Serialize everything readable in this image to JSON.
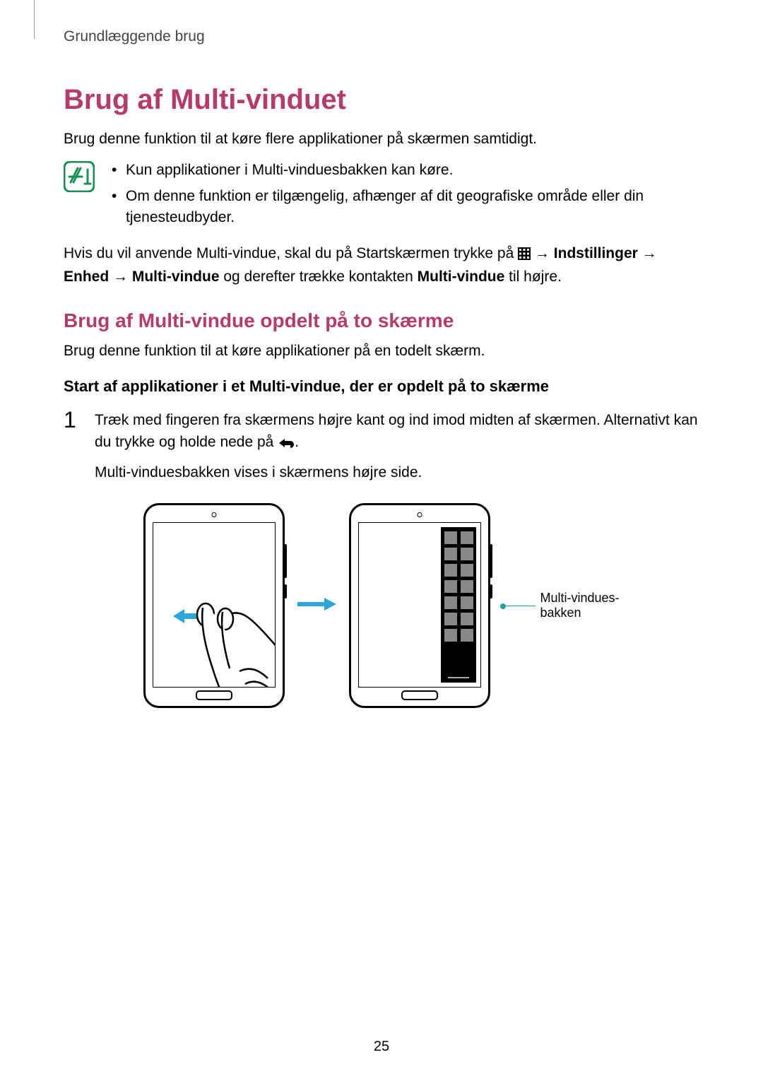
{
  "runningHead": "Grundlæggende brug",
  "title": "Brug af Multi-vinduet",
  "intro": "Brug denne funktion til at køre flere applikationer på skærmen samtidigt.",
  "notes": [
    "Kun applikationer i Multi-vinduesbakken kan køre.",
    "Om denne funktion er tilgængelig, afhænger af dit geografiske område eller din tjenesteudbyder."
  ],
  "para2_pre": "Hvis du vil anvende Multi-vindue, skal du på Startskærmen trykke på ",
  "para2_arrow1": " → ",
  "para2_b1": "Indstillinger",
  "para2_arrow2": " → ",
  "para2_b2": "Enhed",
  "para2_arrow3": " → ",
  "para2_b3": "Multi-vindue",
  "para2_mid": " og derefter trække kontakten ",
  "para2_b4": "Multi-vindue",
  "para2_end": " til højre.",
  "h2": "Brug af Multi-vindue opdelt på to skærme",
  "h2_intro": "Brug denne funktion til at køre applikationer på en todelt skærm.",
  "h3": "Start af applikationer i et Multi-vindue, der er opdelt på to skærme",
  "step1_num": "1",
  "step1_line1a": "Træk med fingeren fra skærmens højre kant og ind imod midten af skærmen. Alternativt kan du trykke og holde nede på ",
  "step1_line1b": ".",
  "step1_line2": "Multi-vinduesbakken vises i skærmens højre side.",
  "callout": "Multi-vindues-\nbakken",
  "pageNumber": "25"
}
